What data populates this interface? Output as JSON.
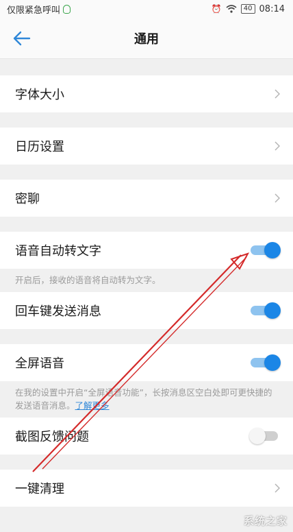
{
  "status_bar": {
    "carrier": "仅限紧急呼叫",
    "battery": "40",
    "time": "08:14",
    "icons": [
      "qq-icon",
      "alarm-icon",
      "wifi-icon",
      "battery-icon"
    ]
  },
  "header": {
    "back_icon": "back-arrow-icon",
    "title": "通用"
  },
  "settings": {
    "font_size": "字体大小",
    "calendar": "日历设置",
    "secret_chat": "密聊",
    "voice_to_text": {
      "label": "语音自动转文字",
      "enabled": true,
      "desc": "开启后，接收的语音将自动转为文字。"
    },
    "enter_send": {
      "label": "回车键发送消息",
      "enabled": true
    },
    "fullscreen_voice": {
      "label": "全屏语音",
      "enabled": true,
      "desc": "在我的设置中开启“全屏语音功能”，长按消息区空白处即可更快捷的发送语音消息。",
      "link": "了解更多"
    },
    "screenshot_feedback": {
      "label": "截图反馈问题",
      "enabled": false
    },
    "one_key_clean": "一键清理"
  },
  "watermark": "系统之家",
  "colors": {
    "accent": "#1b86e6",
    "annotation": "#d42a2a"
  }
}
